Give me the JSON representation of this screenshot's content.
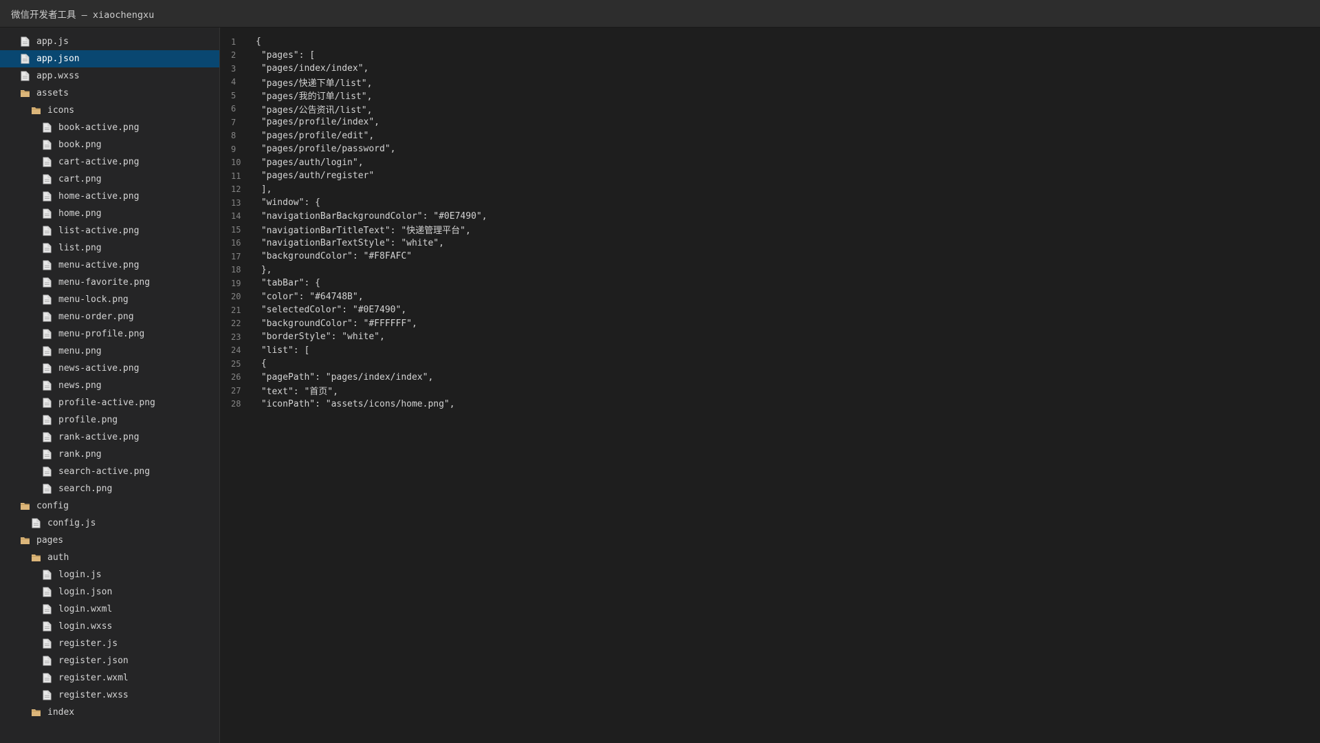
{
  "window": {
    "title": "微信开发者工具 — xiaochengxu"
  },
  "colors": {
    "selection": "#094771",
    "folder_icon": "#dcb67a",
    "file_icon": "#c5c5c5"
  },
  "file_tree": [
    {
      "label": "app.js",
      "type": "file",
      "depth": 1
    },
    {
      "label": "app.json",
      "type": "file",
      "depth": 1,
      "selected": true
    },
    {
      "label": "app.wxss",
      "type": "file",
      "depth": 1
    },
    {
      "label": "assets",
      "type": "folder",
      "depth": 1
    },
    {
      "label": "icons",
      "type": "folder",
      "depth": 2
    },
    {
      "label": "book-active.png",
      "type": "file",
      "depth": 3
    },
    {
      "label": "book.png",
      "type": "file",
      "depth": 3
    },
    {
      "label": "cart-active.png",
      "type": "file",
      "depth": 3
    },
    {
      "label": "cart.png",
      "type": "file",
      "depth": 3
    },
    {
      "label": "home-active.png",
      "type": "file",
      "depth": 3
    },
    {
      "label": "home.png",
      "type": "file",
      "depth": 3
    },
    {
      "label": "list-active.png",
      "type": "file",
      "depth": 3
    },
    {
      "label": "list.png",
      "type": "file",
      "depth": 3
    },
    {
      "label": "menu-active.png",
      "type": "file",
      "depth": 3
    },
    {
      "label": "menu-favorite.png",
      "type": "file",
      "depth": 3
    },
    {
      "label": "menu-lock.png",
      "type": "file",
      "depth": 3
    },
    {
      "label": "menu-order.png",
      "type": "file",
      "depth": 3
    },
    {
      "label": "menu-profile.png",
      "type": "file",
      "depth": 3
    },
    {
      "label": "menu.png",
      "type": "file",
      "depth": 3
    },
    {
      "label": "news-active.png",
      "type": "file",
      "depth": 3
    },
    {
      "label": "news.png",
      "type": "file",
      "depth": 3
    },
    {
      "label": "profile-active.png",
      "type": "file",
      "depth": 3
    },
    {
      "label": "profile.png",
      "type": "file",
      "depth": 3
    },
    {
      "label": "rank-active.png",
      "type": "file",
      "depth": 3
    },
    {
      "label": "rank.png",
      "type": "file",
      "depth": 3
    },
    {
      "label": "search-active.png",
      "type": "file",
      "depth": 3
    },
    {
      "label": "search.png",
      "type": "file",
      "depth": 3
    },
    {
      "label": "config",
      "type": "folder",
      "depth": 1
    },
    {
      "label": "config.js",
      "type": "file",
      "depth": 2
    },
    {
      "label": "pages",
      "type": "folder",
      "depth": 1
    },
    {
      "label": "auth",
      "type": "folder",
      "depth": 2
    },
    {
      "label": "login.js",
      "type": "file",
      "depth": 3
    },
    {
      "label": "login.json",
      "type": "file",
      "depth": 3
    },
    {
      "label": "login.wxml",
      "type": "file",
      "depth": 3
    },
    {
      "label": "login.wxss",
      "type": "file",
      "depth": 3
    },
    {
      "label": "register.js",
      "type": "file",
      "depth": 3
    },
    {
      "label": "register.json",
      "type": "file",
      "depth": 3
    },
    {
      "label": "register.wxml",
      "type": "file",
      "depth": 3
    },
    {
      "label": "register.wxss",
      "type": "file",
      "depth": 3
    },
    {
      "label": "index",
      "type": "folder",
      "depth": 2
    }
  ],
  "editor": {
    "lines": [
      {
        "n": "1",
        "code": "{"
      },
      {
        "n": "2",
        "code": " \"pages\": ["
      },
      {
        "n": "3",
        "code": " \"pages/index/index\","
      },
      {
        "n": "4",
        "code": " \"pages/快递下单/list\","
      },
      {
        "n": "5",
        "code": " \"pages/我的订单/list\","
      },
      {
        "n": "6",
        "code": " \"pages/公告资讯/list\","
      },
      {
        "n": "7",
        "code": " \"pages/profile/index\","
      },
      {
        "n": "8",
        "code": " \"pages/profile/edit\","
      },
      {
        "n": "9",
        "code": " \"pages/profile/password\","
      },
      {
        "n": "10",
        "code": " \"pages/auth/login\","
      },
      {
        "n": "11",
        "code": " \"pages/auth/register\""
      },
      {
        "n": "12",
        "code": " ],"
      },
      {
        "n": "13",
        "code": " \"window\": {"
      },
      {
        "n": "14",
        "code": " \"navigationBarBackgroundColor\": \"#0E7490\","
      },
      {
        "n": "15",
        "code": " \"navigationBarTitleText\": \"快递管理平台\","
      },
      {
        "n": "16",
        "code": " \"navigationBarTextStyle\": \"white\","
      },
      {
        "n": "17",
        "code": " \"backgroundColor\": \"#F8FAFC\""
      },
      {
        "n": "18",
        "code": " },"
      },
      {
        "n": "19",
        "code": " \"tabBar\": {"
      },
      {
        "n": "20",
        "code": " \"color\": \"#64748B\","
      },
      {
        "n": "21",
        "code": " \"selectedColor\": \"#0E7490\","
      },
      {
        "n": "22",
        "code": " \"backgroundColor\": \"#FFFFFF\","
      },
      {
        "n": "23",
        "code": " \"borderStyle\": \"white\","
      },
      {
        "n": "24",
        "code": " \"list\": ["
      },
      {
        "n": "25",
        "code": " {"
      },
      {
        "n": "26",
        "code": " \"pagePath\": \"pages/index/index\","
      },
      {
        "n": "27",
        "code": " \"text\": \"首页\","
      },
      {
        "n": "28",
        "code": " \"iconPath\": \"assets/icons/home.png\","
      }
    ]
  }
}
